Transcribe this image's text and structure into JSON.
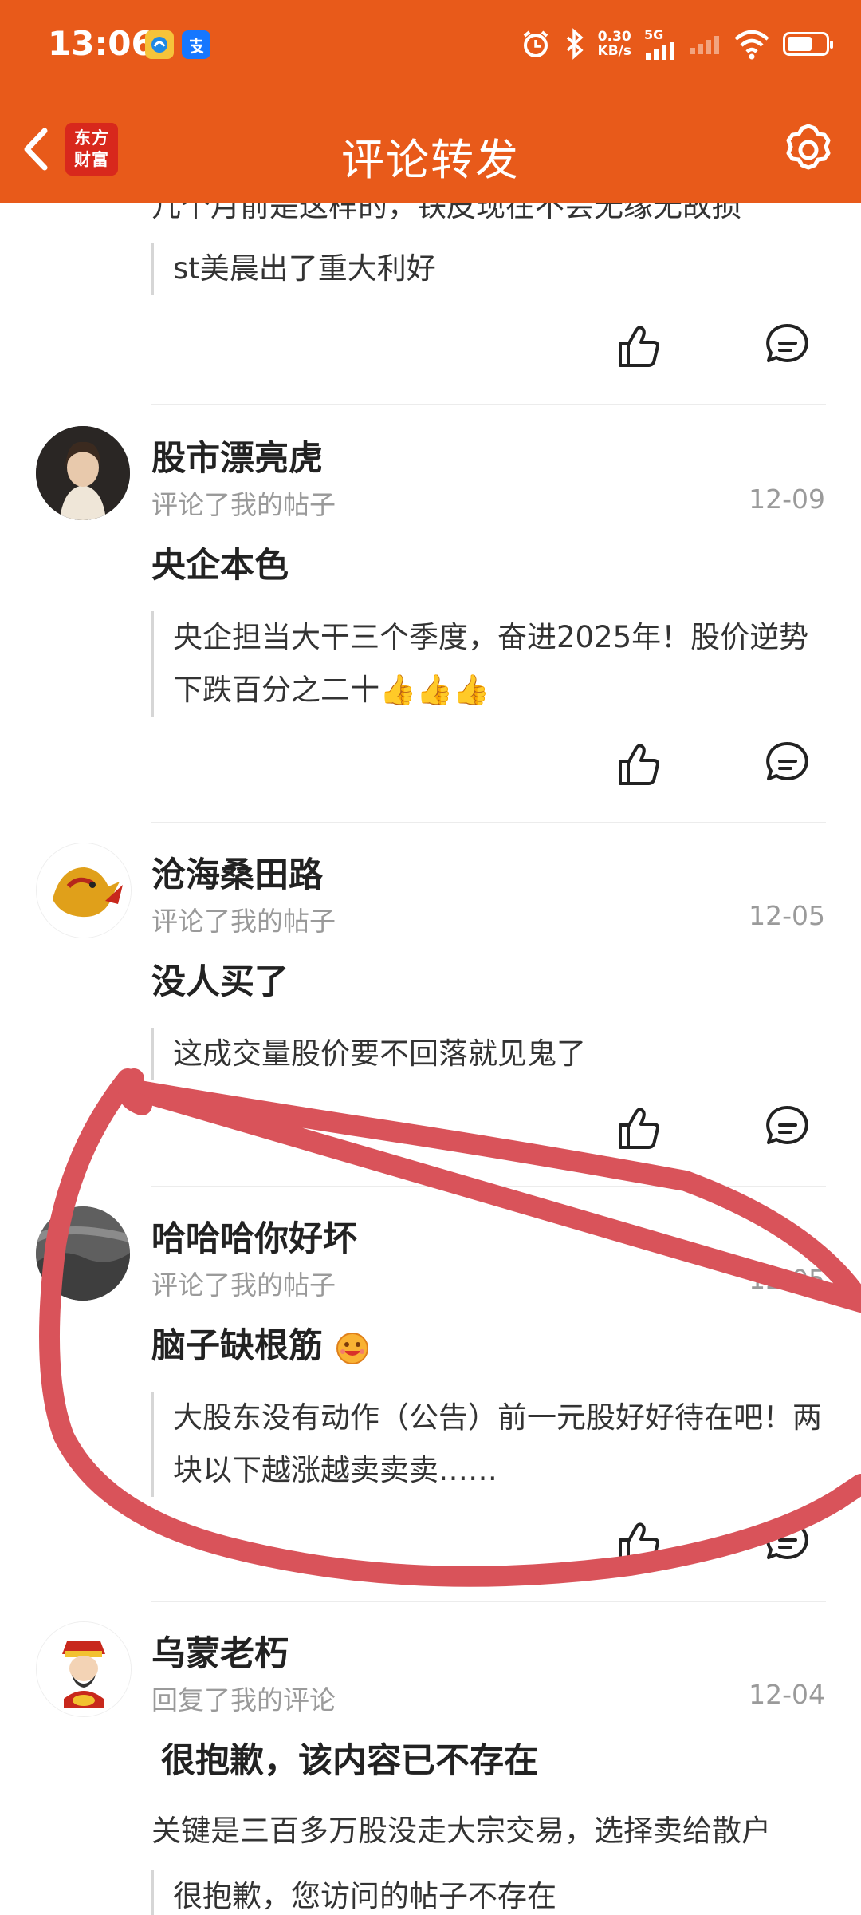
{
  "status_bar": {
    "time": "13:06",
    "net_speed_value": "0.30",
    "net_speed_unit": "KB/s",
    "network": "5G"
  },
  "nav": {
    "logo_line1": "东方",
    "logo_line2": "财富",
    "title": "评论转发"
  },
  "colors": {
    "header": "#e85a1a",
    "logo": "#d8281c",
    "annotation": "#d9535a"
  },
  "feed": {
    "top_partial": {
      "cut_text": "几个月前是这样的，铁皮现在不会无缘无故损",
      "quote": "st美晨出了重大利好"
    },
    "items": [
      {
        "user": "股市漂亮虎",
        "action": "评论了我的帖子",
        "date": "12-09",
        "title": "央企本色",
        "quote": "央企担当大干三个季度，奋进2025年！股价逆势下跌百分之二十👍👍👍"
      },
      {
        "user": "沧海桑田路",
        "action": "评论了我的帖子",
        "date": "12-05",
        "title": "没人买了",
        "quote": "这成交量股价要不回落就见鬼了"
      },
      {
        "user": "哈哈哈你好坏",
        "action": "评论了我的帖子",
        "date": "12-05",
        "title": "脑子缺根筋",
        "quote": "大股东没有动作（公告）前一元股好好待在吧！两块以下越涨越卖卖卖……"
      },
      {
        "user": "乌蒙老朽",
        "action": "回复了我的评论",
        "date": "12-04",
        "title": "很抱歉，该内容已不存在",
        "reply": "关键是三百多万股没走大宗交易，选择卖给散户",
        "quote": "很抱歉，您访问的帖子不存在"
      }
    ]
  }
}
